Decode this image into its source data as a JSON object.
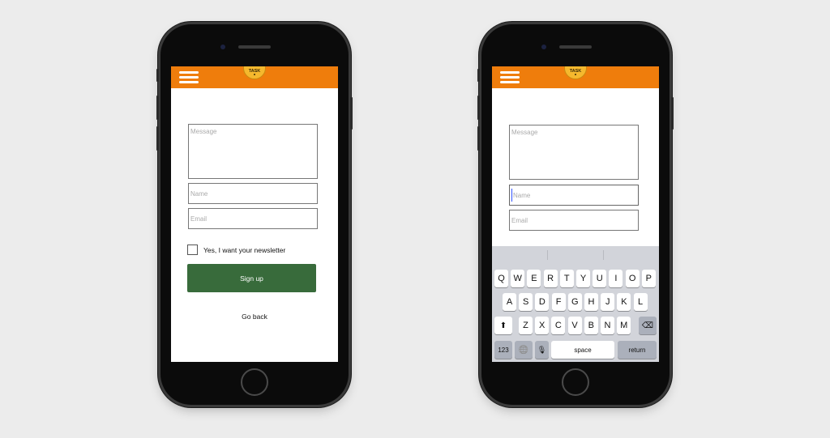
{
  "app": {
    "logo_text": "TASK",
    "brand_color": "#ef7d0c",
    "button_color": "#386b3b"
  },
  "form": {
    "message_placeholder": "Message",
    "name_placeholder": "Name",
    "email_placeholder": "Email",
    "newsletter_label": "Yes, I want your newsletter",
    "signup_label": "Sign up",
    "goback_label": "Go back"
  },
  "keyboard": {
    "row1": [
      "Q",
      "W",
      "E",
      "R",
      "T",
      "Y",
      "U",
      "I",
      "O",
      "P"
    ],
    "row2": [
      "A",
      "S",
      "D",
      "F",
      "G",
      "H",
      "J",
      "K",
      "L"
    ],
    "row3": [
      "Z",
      "X",
      "C",
      "V",
      "B",
      "N",
      "M"
    ],
    "numbers_label": "123",
    "space_label": "space",
    "return_label": "return",
    "shift_icon": "shift-arrow",
    "backspace_icon": "backspace",
    "globe_icon": "globe",
    "mic_icon": "microphone"
  }
}
